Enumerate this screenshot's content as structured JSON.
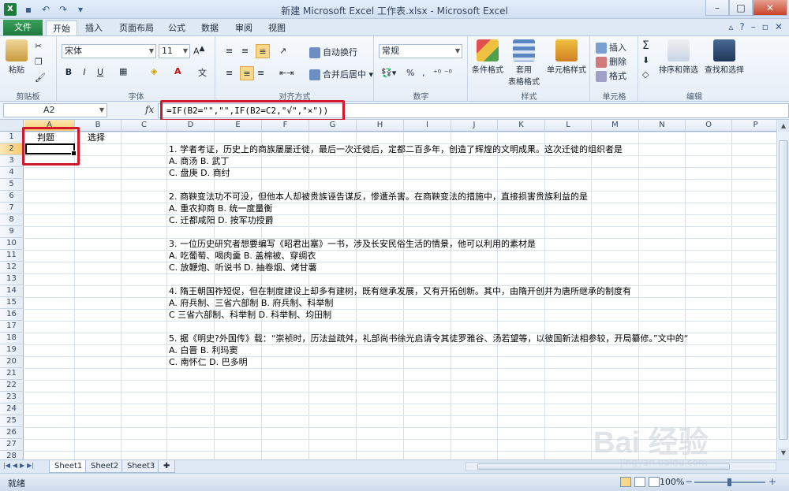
{
  "window": {
    "title": "新建 Microsoft Excel 工作表.xlsx - Microsoft Excel"
  },
  "ribbon_tabs": [
    "文件",
    "开始",
    "插入",
    "页面布局",
    "公式",
    "数据",
    "审阅",
    "视图"
  ],
  "ribbon": {
    "clipboard": {
      "paste": "粘贴",
      "label": "剪贴板"
    },
    "font": {
      "name": "宋体",
      "size": "11",
      "label": "字体",
      "bold": "B",
      "italic": "I",
      "underline": "U"
    },
    "alignment": {
      "wrap": "自动换行",
      "merge": "合并后居中",
      "label": "对齐方式"
    },
    "number": {
      "format": "常规",
      "percent": "%",
      "comma": ",",
      "label": "数字"
    },
    "styles": {
      "conditional": "条件格式",
      "table1": "套用",
      "table2": "表格格式",
      "cell": "单元格样式",
      "label": "样式"
    },
    "cells": {
      "insert": "插入",
      "delete": "删除",
      "format": "格式",
      "label": "单元格"
    },
    "editing": {
      "sum": "Σ",
      "sort": "排序和筛选",
      "find": "查找和选择",
      "label": "编辑"
    }
  },
  "formula_bar": {
    "name_box": "A2",
    "fx": "fx",
    "formula": "=IF(B2=\"\",\"\",IF(B2=C2,\"√\",\"×\"))"
  },
  "columns": [
    "A",
    "B",
    "C",
    "D",
    "E",
    "F",
    "G",
    "H",
    "I",
    "J",
    "K",
    "L",
    "M",
    "N",
    "O",
    "P"
  ],
  "rows": [
    "1",
    "2",
    "3",
    "4",
    "5",
    "6",
    "7",
    "8",
    "9",
    "10",
    "11",
    "12",
    "13",
    "14",
    "15",
    "16",
    "17",
    "18",
    "19",
    "20",
    "21",
    "22",
    "23",
    "24",
    "25",
    "26",
    "27",
    "28"
  ],
  "cells": {
    "A1": "判题",
    "B1": "选择",
    "D2": "1. 学者考证，历史上的商族屡屡迁徙，最后一次迁徙后，定都二百多年，创造了辉煌的文明成果。这次迁徙的组织者是",
    "D3": "A. 商汤 B. 武丁",
    "D4": "C. 盘庚 D. 商纣",
    "D6": "2. 商鞅变法功不可没，但他本人却被贵族诬告谋反，惨遭杀害。在商鞅变法的措施中，直接损害贵族利益的是",
    "D7": "A. 重农抑商 B. 统一度量衡",
    "D8": "C. 迁都咸阳 D. 按军功授爵",
    "D10": "3. 一位历史研究者想要编写《昭君出塞》一书，涉及长安民俗生活的情景，他可以利用的素材是",
    "D11": "A. 吃葡萄、喝肉羹 B. 盖棉被、穿绸衣",
    "D12": "C. 放鞭炮、听说书 D. 抽卷烟、烤甘薯",
    "D14": "4. 隋王朝国祚短促，但在制度建设上却多有建树，既有继承发展，又有开拓创新。其中，由隋开创并为唐所继承的制度有",
    "D15": "A. 府兵制、三省六部制 B. 府兵制、科举制",
    "D16": "C 三省六部制、科举制 D. 科举制、均田制",
    "D18": "5. 据《明史?外国传》载：“崇祯时，历法益疏舛，礼部尚书徐光启请令其徒罗雅谷、汤若望等，以彼国新法相参较，开局纂修。”文中的“",
    "D19": "A. 白晋 B. 利玛窦",
    "D20": "C. 南怀仁 D. 巴多明"
  },
  "sheets": [
    "Sheet1",
    "Sheet2",
    "Sheet3"
  ],
  "status": {
    "ready": "就绪",
    "zoom": "100%"
  },
  "watermark": {
    "brand": "Bai 经验",
    "url": "jingyan.baidu.com"
  }
}
